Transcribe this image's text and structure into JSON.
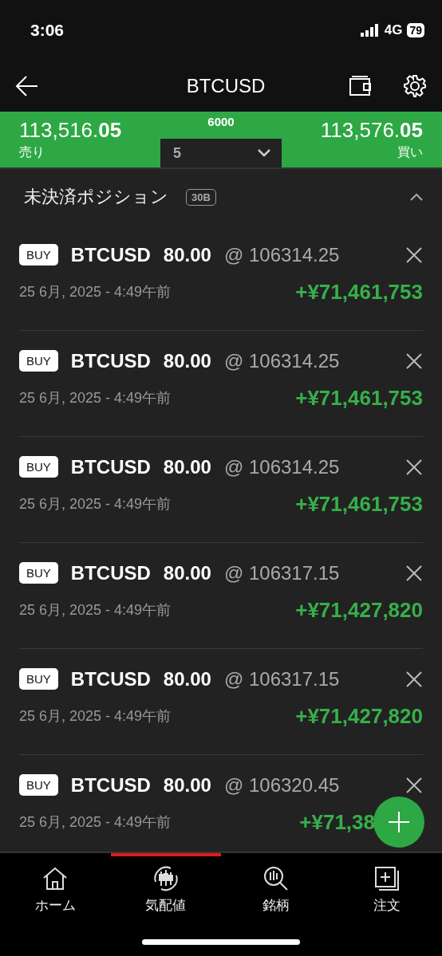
{
  "status_bar": {
    "time": "3:06",
    "network": "4G",
    "battery": "79"
  },
  "header": {
    "title": "BTCUSD"
  },
  "quote": {
    "sell_price": "113,516.**05**",
    "sell_label": "売り",
    "spread": "6000",
    "lot": "5",
    "buy_price": "113,576.**05**",
    "buy_label": "買い"
  },
  "section": {
    "title": "未決済ポジション",
    "badge": "30B",
    "expanded": true
  },
  "positions": [
    {
      "side": "BUY",
      "symbol": "BTCUSD",
      "volume": "80.00",
      "price": "@ 106314.25",
      "date": "25 6月, 2025 - 4:49午前",
      "profit": "+¥71,461,753"
    },
    {
      "side": "BUY",
      "symbol": "BTCUSD",
      "volume": "80.00",
      "price": "@ 106314.25",
      "date": "25 6月, 2025 - 4:49午前",
      "profit": "+¥71,461,753"
    },
    {
      "side": "BUY",
      "symbol": "BTCUSD",
      "volume": "80.00",
      "price": "@ 106314.25",
      "date": "25 6月, 2025 - 4:49午前",
      "profit": "+¥71,461,753"
    },
    {
      "side": "BUY",
      "symbol": "BTCUSD",
      "volume": "80.00",
      "price": "@ 106317.15",
      "date": "25 6月, 2025 - 4:49午前",
      "profit": "+¥71,427,820"
    },
    {
      "side": "BUY",
      "symbol": "BTCUSD",
      "volume": "80.00",
      "price": "@ 106317.15",
      "date": "25 6月, 2025 - 4:49午前",
      "profit": "+¥71,427,820"
    },
    {
      "side": "BUY",
      "symbol": "BTCUSD",
      "volume": "80.00",
      "price": "@ 106320.45",
      "date": "25 6月, 2025 - 4:49午前",
      "profit": "+¥71,38"
    }
  ],
  "bottom_nav": [
    {
      "kind": "home",
      "label": "ホーム",
      "selected": false
    },
    {
      "kind": "quotes",
      "label": "気配値",
      "selected": true
    },
    {
      "kind": "symbols",
      "label": "銘柄",
      "selected": false
    },
    {
      "kind": "order",
      "label": "注文",
      "selected": false
    }
  ]
}
